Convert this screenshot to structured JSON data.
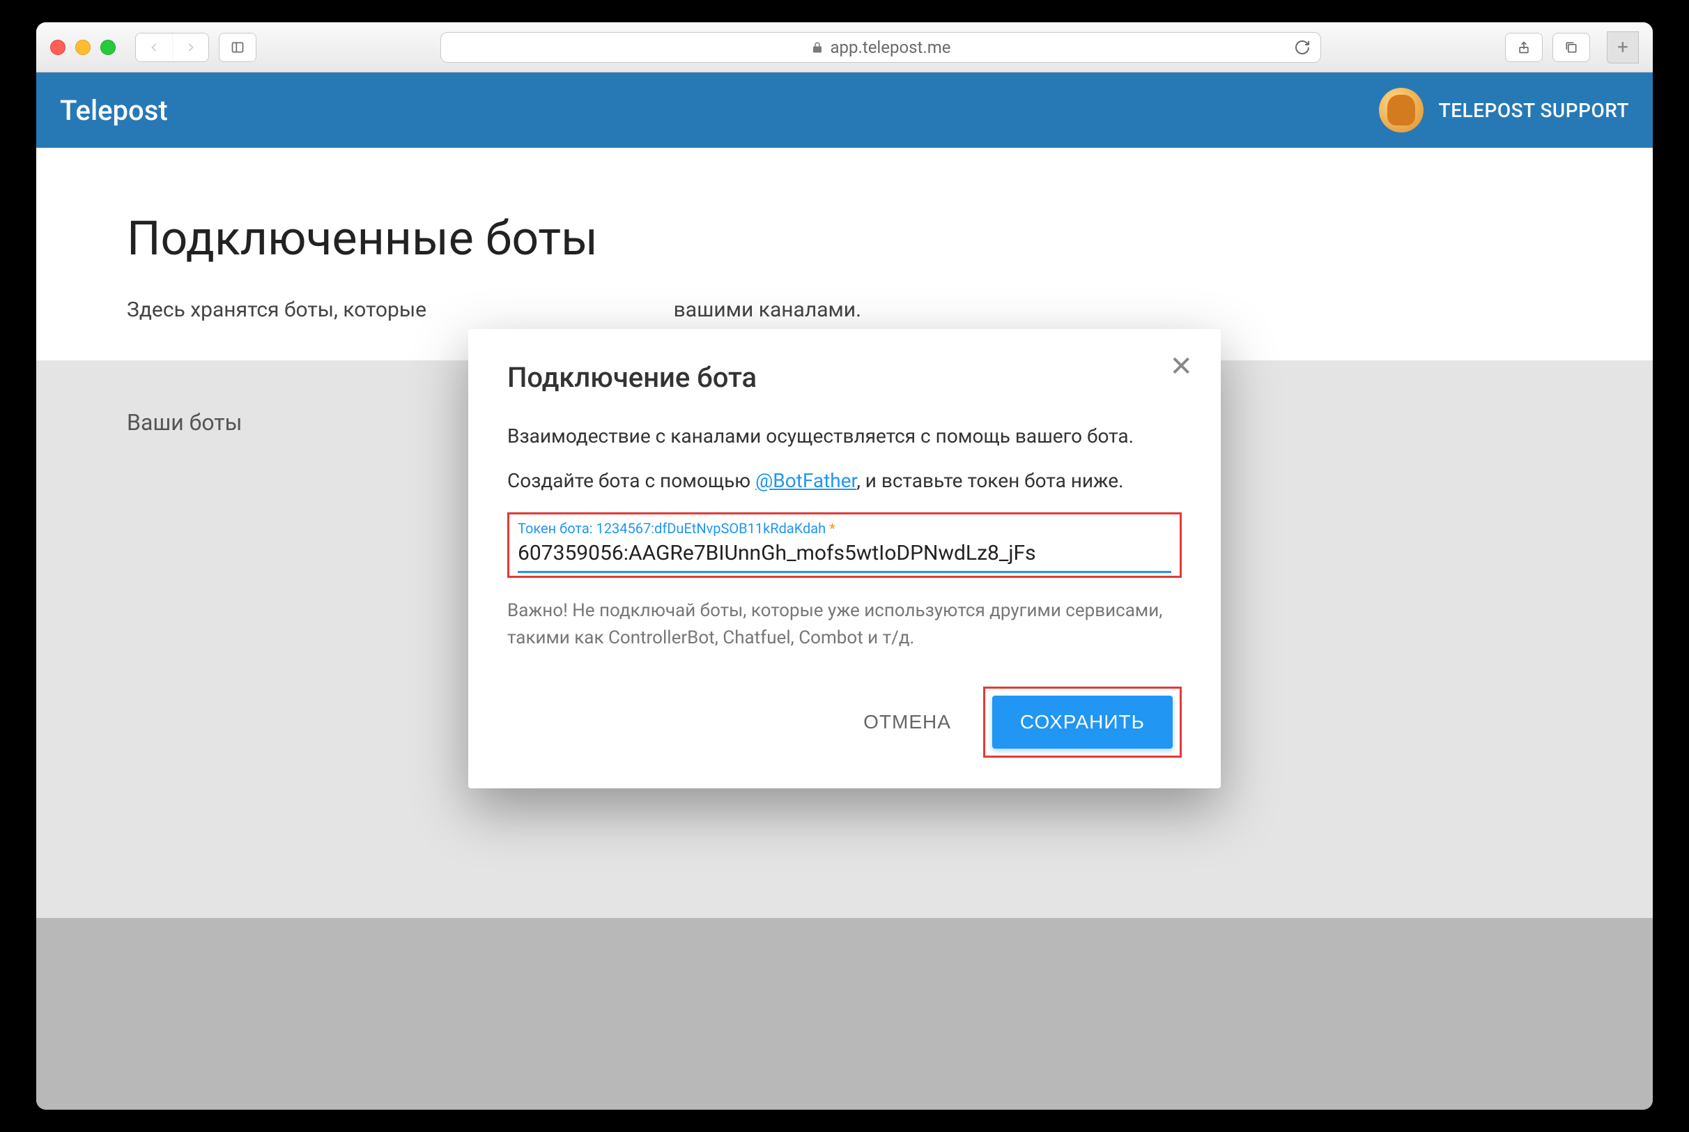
{
  "browser": {
    "url_host": "app.telepost.me"
  },
  "header": {
    "app_name": "Telepost",
    "user_name": "TELEPOST SUPPORT"
  },
  "page": {
    "title": "Подключенные боты",
    "subtitle_prefix": "Здесь хранятся боты, которые",
    "subtitle_suffix": "вашими каналами.",
    "section_label": "Ваши боты"
  },
  "dialog": {
    "title": "Подключение бота",
    "line1": "Взаимодествие с каналами осуществляется с помощь вашего бота.",
    "line2_prefix": "Создайте бота с помощью ",
    "line2_link": "@BotFather",
    "line2_suffix": ", и вставьте токен бота ниже.",
    "input_label": "Токен бота: 1234567:dfDuEtNvpSOB11kRdaKdah",
    "input_value": "607359056:AAGRe7BIUnnGh_mofs5wtIoDPNwdLz8_jFs",
    "note": "Важно! Не подключай боты, которые уже используются другими сервисами, такими как ControllerBot, Chatfuel, Combot и т/д.",
    "cancel_label": "ОТМЕНА",
    "save_label": "СОХРАНИТЬ"
  }
}
